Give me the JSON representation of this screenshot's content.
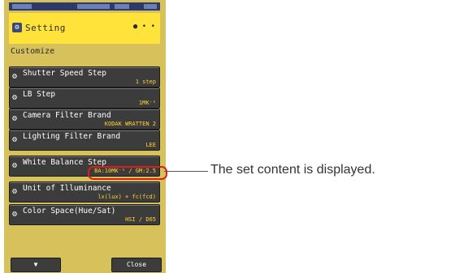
{
  "header": {
    "title": "Setting",
    "page_indicator": "● • •"
  },
  "section_label": "Customize",
  "items": [
    {
      "label": "Shutter Speed Step",
      "value": "1 step"
    },
    {
      "label": "LB Step",
      "value": "1MK⁻¹"
    },
    {
      "label": "Camera Filter Brand",
      "value": "KODAK WRATTEN 2"
    },
    {
      "label": "Lighting Filter Brand",
      "value": "LEE"
    },
    {
      "label": "White Balance Step",
      "value": "BA:10MK⁻¹ / GM:2.5"
    },
    {
      "label": "Unit of Illuminance",
      "value": "lx(lux) + fc(fcd)"
    },
    {
      "label": "Color Space(Hue/Sat)",
      "value": "HSI / D65"
    }
  ],
  "buttons": {
    "down": "▼",
    "close": "Close"
  },
  "callout": "The set content is displayed.",
  "colors": {
    "highlight": "#d91f1f",
    "panel": "#ffe23a",
    "value_text": "#ffd42e"
  }
}
